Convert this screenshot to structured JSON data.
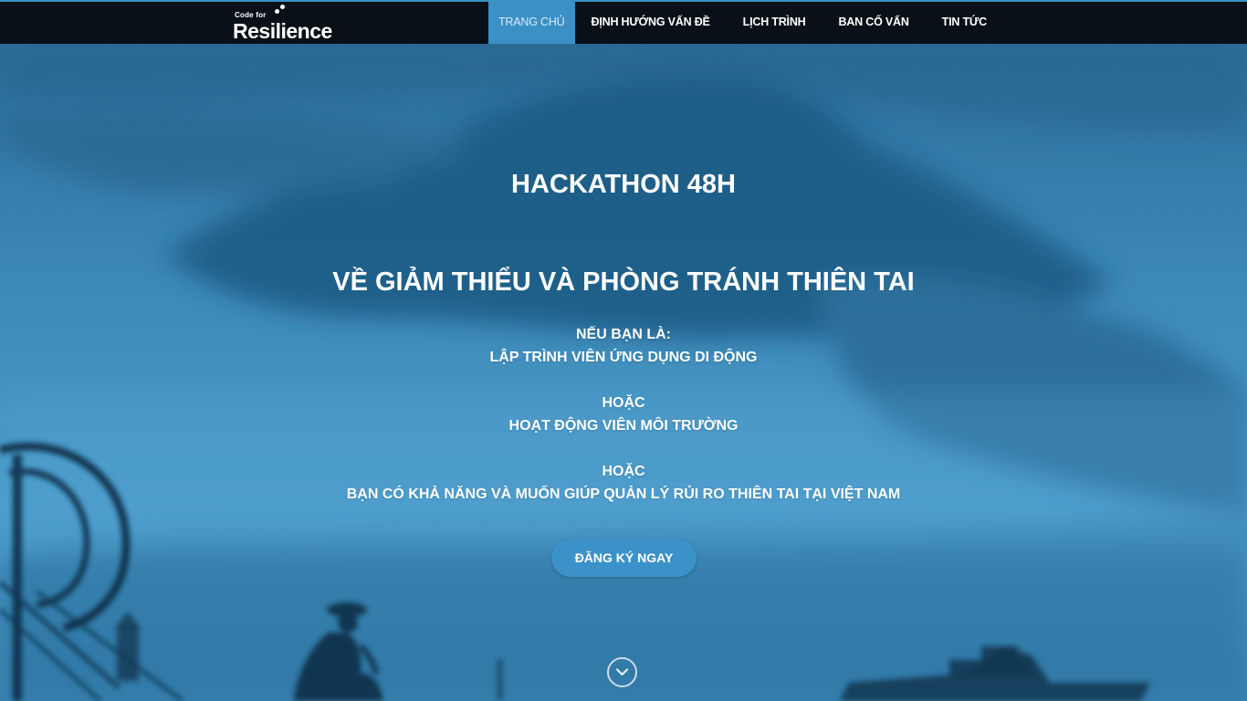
{
  "brand": {
    "small_text": "Code for",
    "big_text": "Resilience"
  },
  "nav": {
    "items": [
      {
        "label": "TRANG CHỦ",
        "active": true
      },
      {
        "label": "ĐỊNH HƯỚNG VẤN ĐỀ",
        "active": false
      },
      {
        "label": "LỊCH TRÌNH",
        "active": false
      },
      {
        "label": "BAN CỐ VẤN",
        "active": false
      },
      {
        "label": "TIN TỨC",
        "active": false
      }
    ]
  },
  "hero": {
    "title": "HACKATHON 48H",
    "subtitle": "VỀ GIẢM THIỂU VÀ PHÒNG TRÁNH THIÊN TAI",
    "lines": [
      "NẾU BẠN LÀ:",
      "LẬP TRÌNH VIÊN ỨNG DỤNG DI ĐỘNG",
      "HOẶC",
      "HOẠT ĐỘNG VIÊN MÔI TRƯỜNG",
      "HOẶC",
      "BẠN CÓ KHẢ NĂNG VÀ MUỐN GIÚP QUẢN LÝ RỦI RO THIÊN TAI TẠI VIỆT NAM"
    ],
    "cta_label": "ĐĂNG KÝ NGAY",
    "scroll_icon": "chevron-down-circle-icon"
  },
  "colors": {
    "accent": "#3b91c6",
    "navbar": "#0a1017",
    "hero_tint": "#3f8fbd"
  }
}
